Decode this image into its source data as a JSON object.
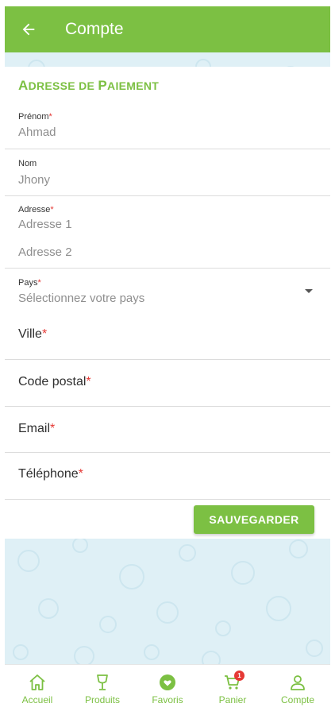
{
  "header": {
    "title": "Compte"
  },
  "section": {
    "title_first": "A",
    "title_rest": "DRESSE DE ",
    "title_first2": "P",
    "title_rest2": "AIEMENT"
  },
  "fields": {
    "prenom": {
      "label": "Prénom",
      "value": "Ahmad"
    },
    "nom": {
      "label": "Nom",
      "value": "Jhony"
    },
    "adresse": {
      "label": "Adresse",
      "placeholder1": "Adresse 1",
      "placeholder2": "Adresse 2"
    },
    "pays": {
      "label": "Pays",
      "placeholder": "Sélectionnez votre pays"
    },
    "ville": {
      "label": "Ville"
    },
    "code_postal": {
      "label": "Code postal"
    },
    "email": {
      "label": "Email"
    },
    "telephone": {
      "label": "Téléphone"
    },
    "required_mark": "*"
  },
  "actions": {
    "save_label": "SAUVEGARDER"
  },
  "bottom_nav": {
    "items": [
      {
        "label": "Accueil",
        "icon": "home-icon"
      },
      {
        "label": "Produits",
        "icon": "glass-icon"
      },
      {
        "label": "Favoris",
        "icon": "heart-icon"
      },
      {
        "label": "Panier",
        "icon": "cart-icon",
        "badge": "1"
      },
      {
        "label": "Compte",
        "icon": "user-icon"
      }
    ]
  },
  "colors": {
    "accent": "#7cc043",
    "required": "#e53935",
    "background": "#dff0f6"
  }
}
